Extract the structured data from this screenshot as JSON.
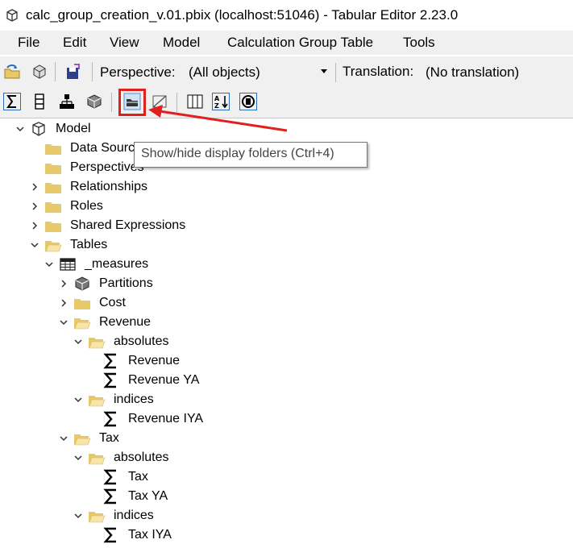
{
  "window": {
    "title": "calc_group_creation_v.01.pbix (localhost:51046) - Tabular Editor 2.23.0"
  },
  "menu": {
    "items": [
      "File",
      "Edit",
      "View",
      "Model",
      "Calculation Group Table",
      "Tools"
    ]
  },
  "toolbar": {
    "perspective_label": "Perspective:",
    "perspective_value": "(All objects)",
    "translation_label": "Translation:",
    "translation_value": "(No translation)"
  },
  "tooltip": {
    "text": "Show/hide display folders (Ctrl+4)"
  },
  "colors": {
    "annotation": "#e0201c",
    "folder": "#e8c96a"
  },
  "tree": {
    "model_label": "Model",
    "rows": [
      {
        "label": "Data Sources",
        "icon": "folder-icon"
      },
      {
        "label": "Perspectives",
        "icon": "folder-icon"
      },
      {
        "label": "Relationships",
        "icon": "folder-icon"
      },
      {
        "label": "Roles",
        "icon": "folder-icon"
      },
      {
        "label": "Shared Expressions",
        "icon": "folder-icon"
      },
      {
        "label": "Tables",
        "icon": "folder-open-icon"
      },
      {
        "label": "_measures",
        "icon": "table-icon"
      },
      {
        "label": "Partitions",
        "icon": "partitions-icon"
      },
      {
        "label": "Cost",
        "icon": "folder-icon"
      },
      {
        "label": "Revenue",
        "icon": "folder-open-icon"
      },
      {
        "label": "absolutes",
        "icon": "folder-open-icon"
      },
      {
        "label": "Revenue",
        "icon": "sigma-icon"
      },
      {
        "label": "Revenue YA",
        "icon": "sigma-icon"
      },
      {
        "label": "indices",
        "icon": "folder-open-icon"
      },
      {
        "label": "Revenue IYA",
        "icon": "sigma-icon"
      },
      {
        "label": "Tax",
        "icon": "folder-open-icon"
      },
      {
        "label": "absolutes",
        "icon": "folder-open-icon"
      },
      {
        "label": "Tax",
        "icon": "sigma-icon"
      },
      {
        "label": "Tax YA",
        "icon": "sigma-icon"
      },
      {
        "label": "indices",
        "icon": "folder-open-icon"
      },
      {
        "label": "Tax IYA",
        "icon": "sigma-icon"
      }
    ]
  }
}
